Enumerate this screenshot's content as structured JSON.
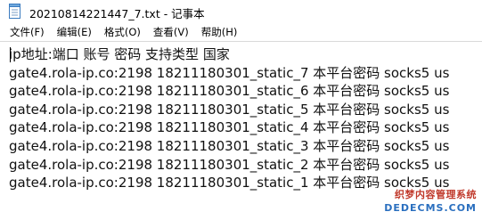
{
  "window": {
    "title": "20210814221447_7.txt - 记事本",
    "icon": "notepad-icon"
  },
  "menu": {
    "items": [
      {
        "label": "文件(F)"
      },
      {
        "label": "编辑(E)"
      },
      {
        "label": "格式(O)"
      },
      {
        "label": "查看(V)"
      },
      {
        "label": "帮助(H)"
      }
    ]
  },
  "editor": {
    "lines": [
      "ip地址:端口 账号 密码 支持类型 国家",
      "gate4.rola-ip.co:2198 18211180301_static_7 本平台密码 socks5 us",
      "gate4.rola-ip.co:2198 18211180301_static_6 本平台密码 socks5 us",
      "gate4.rola-ip.co:2198 18211180301_static_5 本平台密码 socks5 us",
      "gate4.rola-ip.co:2198 18211180301_static_4 本平台密码 socks5 us",
      "gate4.rola-ip.co:2198 18211180301_static_3 本平台密码 socks5 us",
      "gate4.rola-ip.co:2198 18211180301_static_2 本平台密码 socks5 us",
      "gate4.rola-ip.co:2198 18211180301_static_1 本平台密码 socks5 us"
    ]
  },
  "watermark": {
    "line1": "织梦内容管理系统",
    "line2": "DEDECMS.COM"
  }
}
